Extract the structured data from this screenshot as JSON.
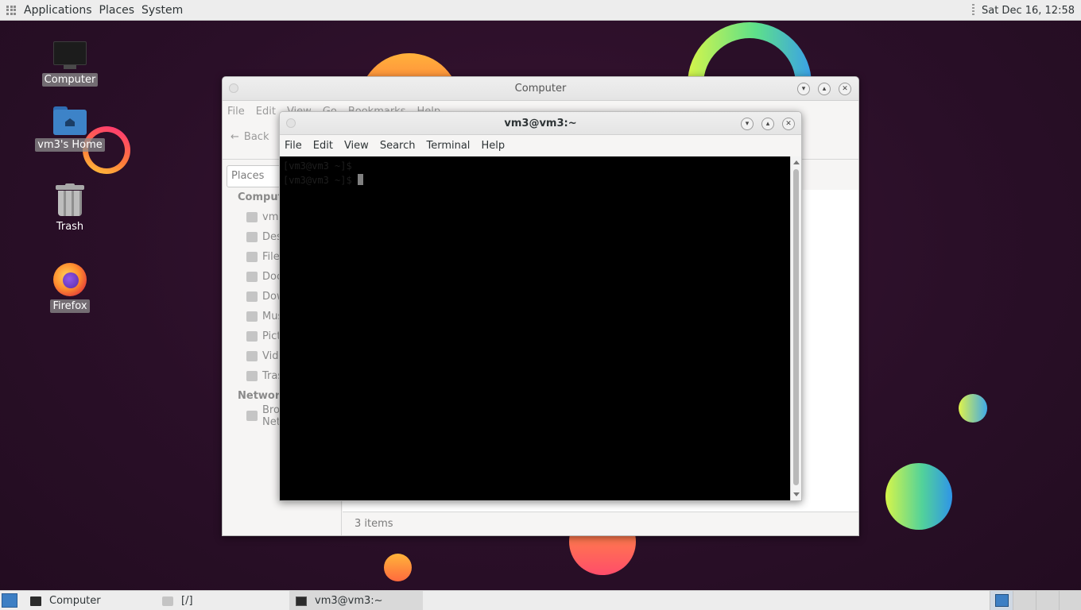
{
  "top_panel": {
    "menus": [
      "Applications",
      "Places",
      "System"
    ],
    "clock": "Sat Dec 16, 12:58"
  },
  "desktop": {
    "icons": [
      {
        "label": "Computer",
        "icon": "computer-icon"
      },
      {
        "label": "vm3's Home",
        "icon": "home-folder-icon"
      },
      {
        "label": "Trash",
        "icon": "trash-icon"
      },
      {
        "label": "Firefox",
        "icon": "firefox-icon"
      }
    ]
  },
  "file_manager": {
    "title": "Computer",
    "menus": [
      "File",
      "Edit",
      "View",
      "Go",
      "Bookmarks",
      "Help"
    ],
    "back_label": "Back",
    "places_label": "Places",
    "sidebar": {
      "section_computer": "Computer",
      "items": [
        "vm3",
        "Desktop",
        "File System",
        "Documents",
        "Downloads",
        "Music",
        "Pictures",
        "Videos",
        "Trash"
      ],
      "section_network": "Network",
      "network_items": [
        "Browse Network"
      ]
    },
    "status": "3 items"
  },
  "terminal": {
    "title": "vm3@vm3:~",
    "menus": [
      "File",
      "Edit",
      "View",
      "Search",
      "Terminal",
      "Help"
    ],
    "lines": [
      "[vm3@vm3 ~]$",
      "[vm3@vm3 ~]$ "
    ]
  },
  "taskbar": {
    "tasks": [
      {
        "label": "Computer",
        "icon": "computer-icon"
      },
      {
        "label": "[/]",
        "icon": "folder-icon"
      },
      {
        "label": "vm3@vm3:~",
        "icon": "terminal-icon"
      }
    ]
  }
}
